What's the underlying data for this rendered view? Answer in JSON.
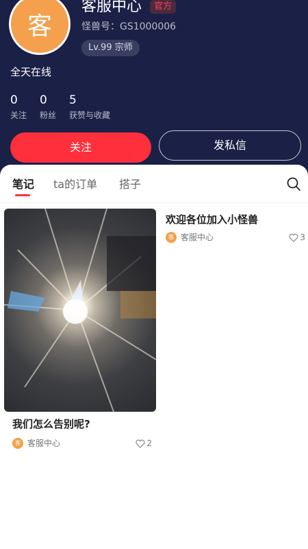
{
  "profile": {
    "avatar_char": "客",
    "name": "客服中心",
    "official_badge": "官方",
    "uid_text": "怪兽号：GS1000006",
    "level_text": "Lv.99 宗师",
    "bio": "全天在线",
    "stats": [
      {
        "value": "0",
        "label": "关注"
      },
      {
        "value": "0",
        "label": "粉丝"
      },
      {
        "value": "5",
        "label": "获赞与收藏"
      }
    ],
    "follow_label": "关注",
    "message_label": "发私信"
  },
  "tabs": [
    {
      "label": "笔记",
      "active": true
    },
    {
      "label": "ta的订单",
      "active": false
    },
    {
      "label": "搭子",
      "active": false
    }
  ],
  "notes": [
    {
      "title": "我们怎么告别呢?",
      "author": "客服中心",
      "avatar_char": "客",
      "likes": "2",
      "has_cover": true
    },
    {
      "title": "欢迎各位加入小怪兽",
      "author": "客服中心",
      "avatar_char": "客",
      "likes": "3",
      "has_cover": false
    }
  ],
  "icons": {
    "search": "search-icon",
    "like": "heart-outline-icon"
  },
  "colors": {
    "header_bg": "#1b2046",
    "accent": "#ff2f3c",
    "avatar": "#f4a04c"
  }
}
